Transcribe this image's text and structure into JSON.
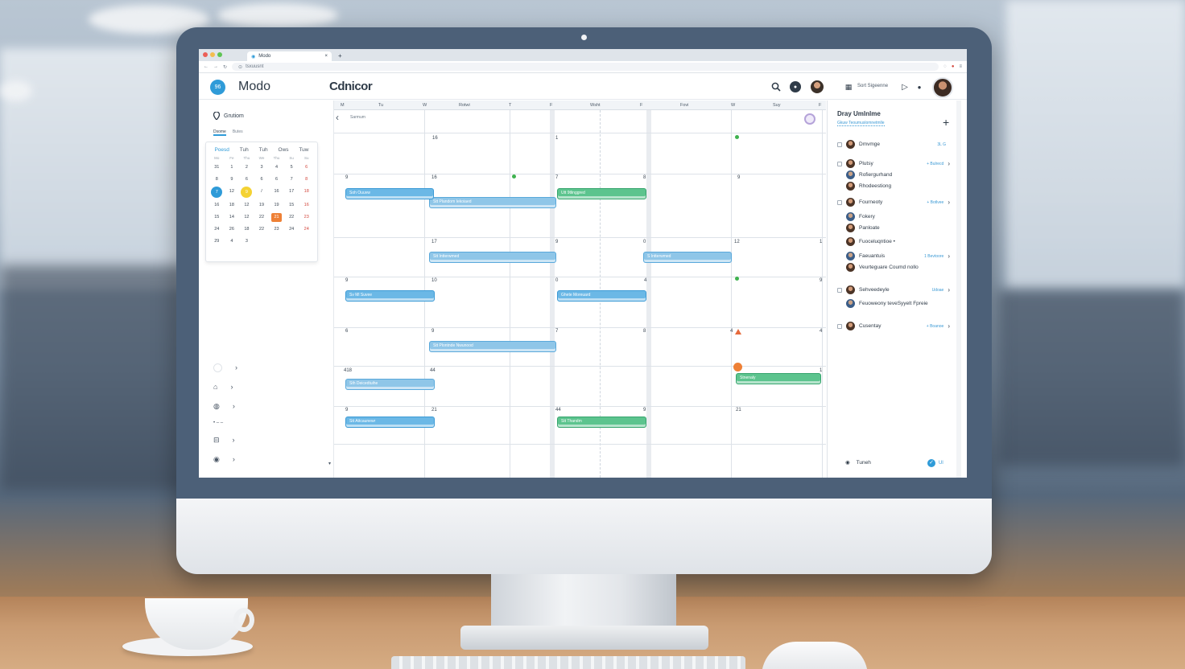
{
  "browser": {
    "tab_title": "Modo",
    "tab_close": "×",
    "new_tab": "+",
    "address": "tsxuusnt"
  },
  "app": {
    "logo_text": "96",
    "brand": "Modo",
    "title": "Cdnicor",
    "header_action_text": "Sort Sigeenne"
  },
  "sidebar": {
    "location_label": "Grutiom",
    "subtabs": [
      "Dsome",
      "Butes"
    ],
    "mini_calendar": {
      "header": [
        "Poesd",
        "Tuh",
        "Tuh",
        "Ows",
        "Tuw"
      ],
      "weekdays": [
        "Mo",
        "Fe",
        "Thu",
        "We",
        "Thu",
        "Su",
        "Su"
      ],
      "days": [
        "31",
        "1",
        "2",
        "3",
        "4",
        "5",
        "6",
        "8",
        "9",
        "6",
        "6",
        "6",
        "7",
        "8",
        "7",
        "12",
        "9",
        "/",
        "16",
        "17",
        "18",
        "16",
        "18",
        "12",
        "19",
        "19",
        "15",
        "16",
        "15",
        "14",
        "12",
        "22",
        "21",
        "22",
        "23",
        "24",
        "26",
        "18",
        "22",
        "23",
        "24",
        "24",
        "29",
        "4",
        "3",
        "",
        "",
        "",
        ""
      ]
    },
    "nav_items": [
      "",
      "",
      "",
      "",
      "",
      ""
    ]
  },
  "calendar": {
    "column_headers": [
      "M",
      "Tu",
      "W",
      "Rotwi",
      "T",
      "F",
      "Wsht",
      "F",
      "Fovi",
      "W",
      "Suy",
      "F"
    ],
    "range_label": "Sarmum",
    "rows": [
      {
        "day_numbers": [
          "16",
          "1"
        ]
      },
      {
        "day_numbers": [
          "9",
          "16",
          "7",
          "8",
          "9"
        ]
      },
      {
        "day_numbers": [
          "17",
          "9",
          "0",
          "12",
          "1"
        ]
      },
      {
        "day_numbers": [
          "9",
          "10",
          "0",
          "4",
          "9"
        ]
      },
      {
        "day_numbers": [
          "6",
          "9",
          "7",
          "8",
          "4",
          "4"
        ]
      },
      {
        "day_numbers": [
          "418",
          "44",
          "1"
        ]
      },
      {
        "day_numbers": [
          "9",
          "21",
          "44",
          "9",
          "21"
        ]
      }
    ],
    "events": [
      {
        "label": "Stt Plandom Iekoiaed",
        "color": "lblue"
      },
      {
        "label": "Soh Ouuvw",
        "color": "blue"
      },
      {
        "label": "Utt 9tlinggred",
        "color": "green"
      },
      {
        "label": "Stt Intterwmed",
        "color": "lblue"
      },
      {
        "label": "S Intterwmed",
        "color": "lblue"
      },
      {
        "label": "Sv Ml Suvee",
        "color": "blue"
      },
      {
        "label": "Ghete Moreuard",
        "color": "blue"
      },
      {
        "label": "Stt Plontnde Nwunood",
        "color": "lblue"
      },
      {
        "label": "Sth Deicedtuihe",
        "color": "lblue"
      },
      {
        "label": "Stnenaly",
        "color": "green"
      },
      {
        "label": "Stt Attcaunewr",
        "color": "blue"
      },
      {
        "label": "Stt Thandm",
        "color": "green"
      }
    ]
  },
  "right_panel": {
    "title": "Dray Umlnlme",
    "subtitle": "Gkuw Teoumuslomnetmlle",
    "add": "+",
    "items": [
      {
        "name": "Dmvmge",
        "meta": "3L G",
        "arrow": "",
        "checkbox": true
      },
      {
        "name": "Plutsy",
        "meta": "+ Bulrecd",
        "arrow": "›",
        "checkbox": true
      },
      {
        "name": "Rofiergurhand",
        "meta": "",
        "arrow": "",
        "checkbox": false
      },
      {
        "name": "Rhodeestiong",
        "meta": "",
        "arrow": "",
        "checkbox": false
      },
      {
        "name": "Fourneoty",
        "meta": "+ Botlvee",
        "arrow": "›",
        "checkbox": true
      },
      {
        "name": "Fokery",
        "meta": "",
        "arrow": "",
        "checkbox": false
      },
      {
        "name": "Panloate",
        "meta": "",
        "arrow": "",
        "checkbox": false
      },
      {
        "name": "Fuoceluqntioe •",
        "meta": "",
        "arrow": "",
        "checkbox": false
      },
      {
        "name": "Faeuantuis",
        "meta": "1 Bevtoore",
        "arrow": "›",
        "checkbox": false
      },
      {
        "name": "Veurteguare Coumd nollo",
        "meta": "",
        "arrow": "",
        "checkbox": false
      },
      {
        "name": "Sehveedeyle",
        "meta": "Udoae",
        "arrow": "›",
        "checkbox": true
      },
      {
        "name": "Feuoweony teveSyyelt Fpreie",
        "meta": "",
        "arrow": "",
        "checkbox": false
      },
      {
        "name": "Cusentay",
        "meta": "+ Boanoe",
        "arrow": "›",
        "checkbox": true
      }
    ],
    "footer_left": "Tuneh",
    "footer_right": "Ul"
  },
  "colors": {
    "accent": "#2f9bd8",
    "event_blue": "#6bb8e6",
    "event_green": "#5cc48e",
    "today_yellow": "#f4d233",
    "orange": "#ee8036"
  }
}
